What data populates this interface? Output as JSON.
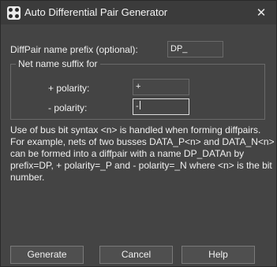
{
  "window": {
    "title": "Auto Differential Pair Generator",
    "close_glyph": "✕"
  },
  "form": {
    "prefix_label": "DiffPair name prefix (optional):",
    "prefix_value": "DP_",
    "suffix_group_label": "Net name suffix for",
    "plus_label": "+ polarity:",
    "plus_value": "+",
    "minus_label": "- polarity:",
    "minus_value": "-"
  },
  "description": [
    "Use of bus bit syntax <n> is handled when forming diffpairs.",
    "For example, nets of two busses DATA_P<n> and DATA_N<n>",
    "can be formed into a diffpair with a name DP_DATAn by",
    "prefix=DP, + polarity=_P and - polarity=_N where <n> is the bit",
    "number."
  ],
  "buttons": {
    "generate": "Generate",
    "cancel": "Cancel",
    "help": "Help"
  },
  "icons": {
    "app": "app-icon",
    "close": "close-icon"
  },
  "colors": {
    "window_bg": "#444444",
    "titlebar_bg": "#3b3b3b",
    "text": "#f0f0f0",
    "field_border": "#6a6a6a",
    "focused_border": "#dcdcdc"
  }
}
